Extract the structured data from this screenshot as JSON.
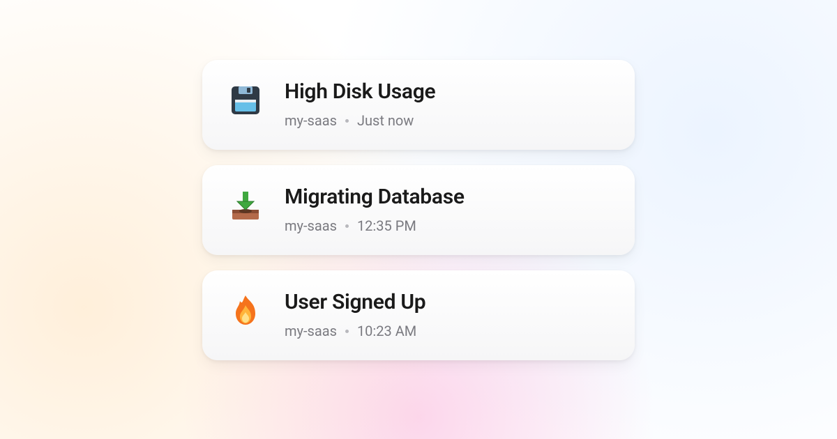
{
  "notifications": [
    {
      "icon": "floppy-disk-icon",
      "title": "High Disk Usage",
      "project": "my-saas",
      "time": "Just now"
    },
    {
      "icon": "download-tray-icon",
      "title": "Migrating Database",
      "project": "my-saas",
      "time": "12:35 PM"
    },
    {
      "icon": "fire-icon",
      "title": "User Signed Up",
      "project": "my-saas",
      "time": "10:23 AM"
    }
  ]
}
